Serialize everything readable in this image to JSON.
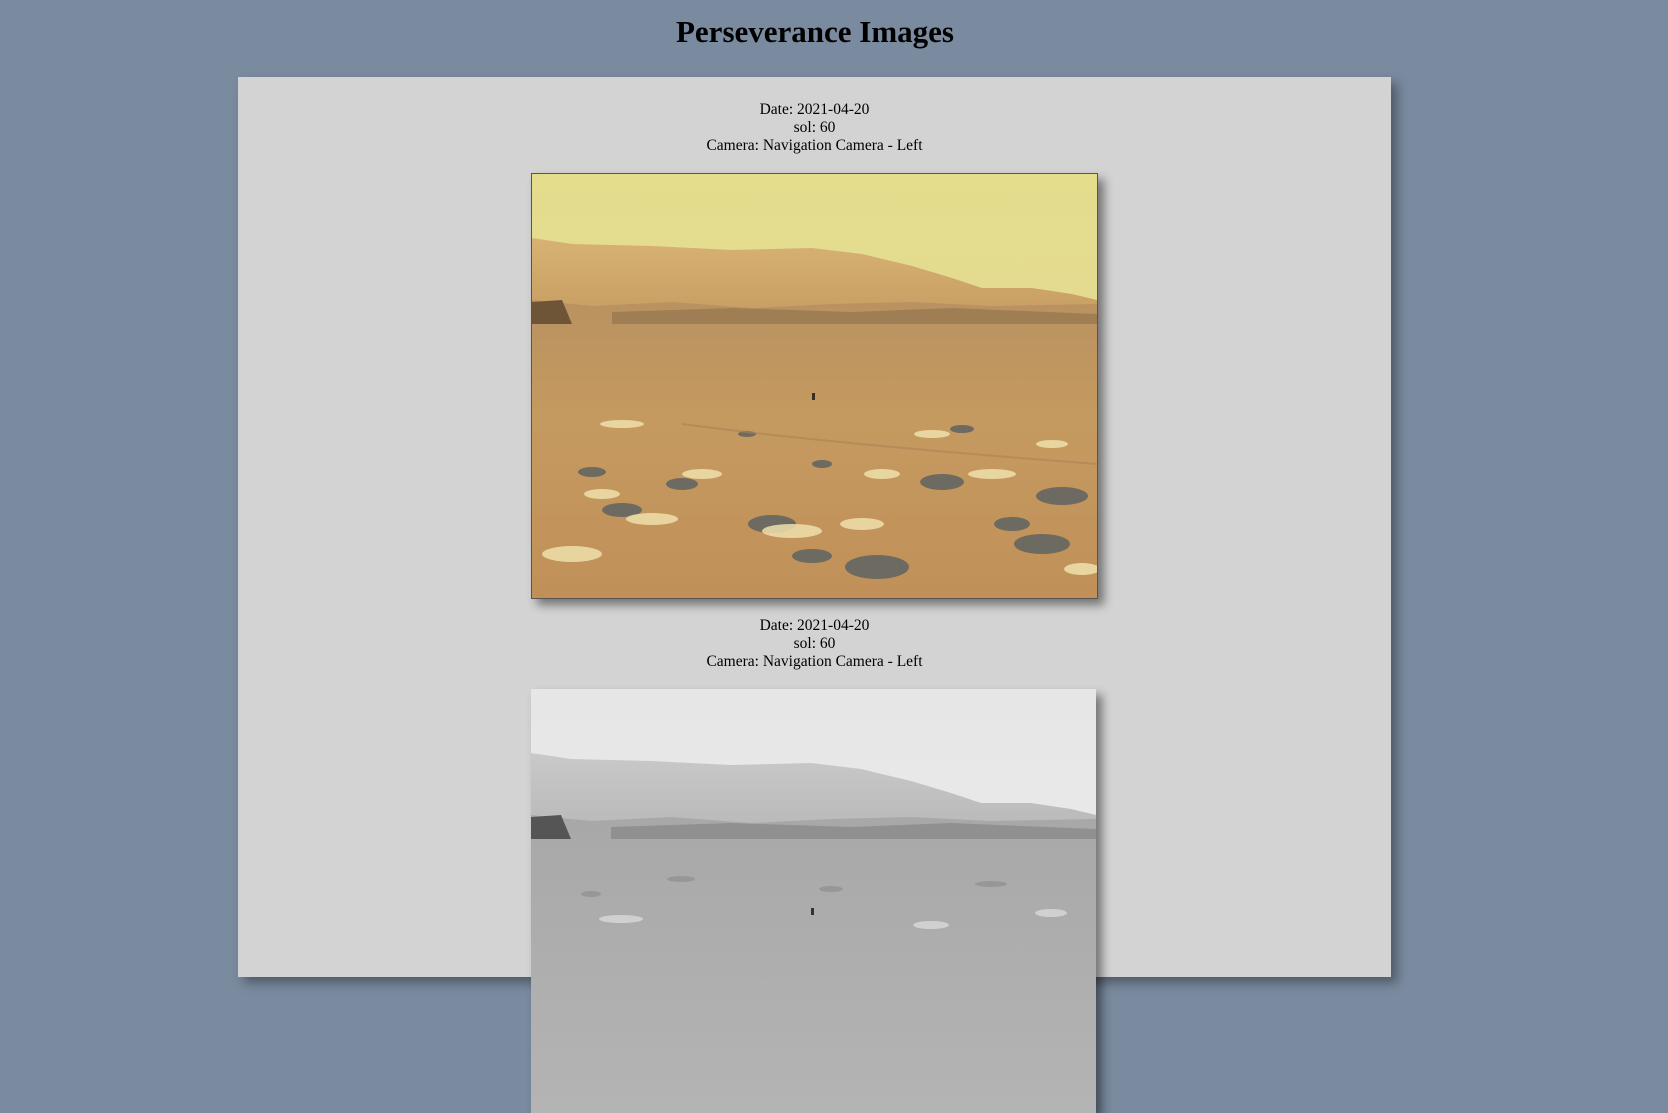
{
  "page": {
    "title": "Perseverance Images"
  },
  "photos": [
    {
      "date_line": "Date: 2021-04-20",
      "sol_line": "sol: 60",
      "camera_line": "Camera: Navigation Camera - Left",
      "style": "color"
    },
    {
      "date_line": "Date: 2021-04-20",
      "sol_line": "sol: 60",
      "camera_line": "Camera: Navigation Camera - Left",
      "style": "grayscale"
    }
  ],
  "colors": {
    "background": "#7a8a9f",
    "panel": "#d3d3d3"
  }
}
